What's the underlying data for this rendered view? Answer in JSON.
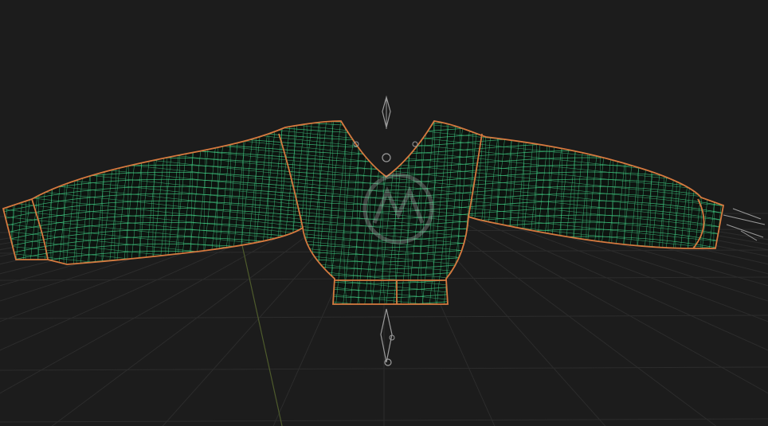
{
  "viewport": {
    "background": "#1c1c1c",
    "grid_color": "#2c2c2c",
    "axis_y_color": "#4e5b2c",
    "mesh": {
      "fill": "#0d1410",
      "wire_color": "#45e08f",
      "seam_color": "#d6793f"
    },
    "rig_color": "#9a9a9a",
    "watermark_icon": "logo-watermark-icon",
    "rig_icons": [
      "rig-pivot-top-icon",
      "rig-joint-icon",
      "rig-pivot-bottom-icon",
      "rig-arrow-right-icon"
    ]
  }
}
